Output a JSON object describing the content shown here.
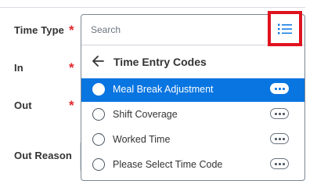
{
  "form": {
    "labels": {
      "time_type": "Time Type",
      "in": "In",
      "out": "Out",
      "out_reason": "Out Reason"
    },
    "required_marker": "*"
  },
  "dropdown": {
    "search_placeholder": "Search",
    "header_title": "Time Entry Codes",
    "options": [
      {
        "label": "Meal Break Adjustment",
        "selected": true
      },
      {
        "label": "Shift Coverage",
        "selected": false
      },
      {
        "label": "Worked Time",
        "selected": false
      },
      {
        "label": "Please Select Time Code",
        "selected": false
      }
    ]
  },
  "colors": {
    "accent": "#0875e1",
    "required": "#e3262c",
    "highlight_box": "#e0121f"
  },
  "icons": {
    "prompt": "list-icon",
    "back": "arrow-left-icon",
    "more": "more-horizontal-icon"
  }
}
